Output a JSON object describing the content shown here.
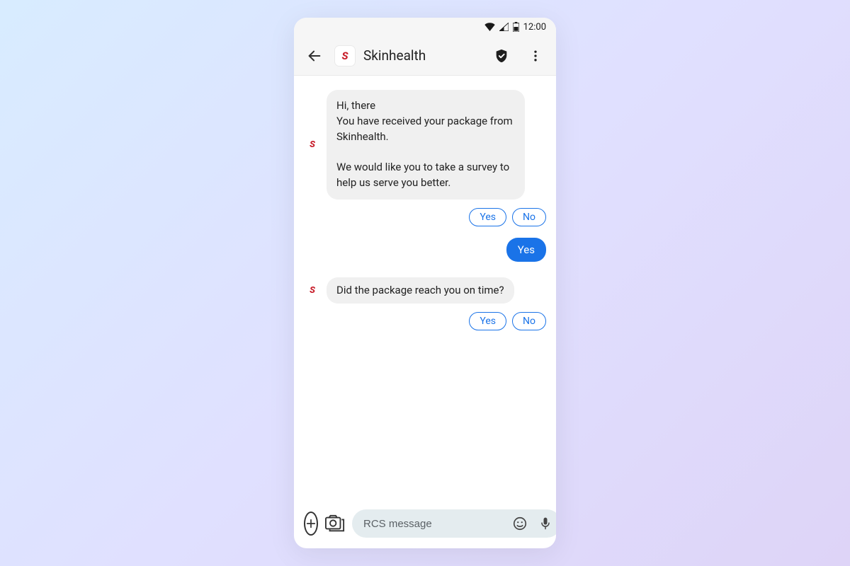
{
  "status_bar": {
    "time": "12:00"
  },
  "header": {
    "title": "Skinhealth"
  },
  "messages": {
    "m0": "Hi, there\nYou have received your package from Skinhealth.\n\nWe would like you to take a survey to help us serve you better.",
    "m1": "Did the package reach you on time?"
  },
  "chips": {
    "yes": "Yes",
    "no": "No"
  },
  "user_reply": "Yes",
  "composer": {
    "placeholder": "RCS message"
  }
}
